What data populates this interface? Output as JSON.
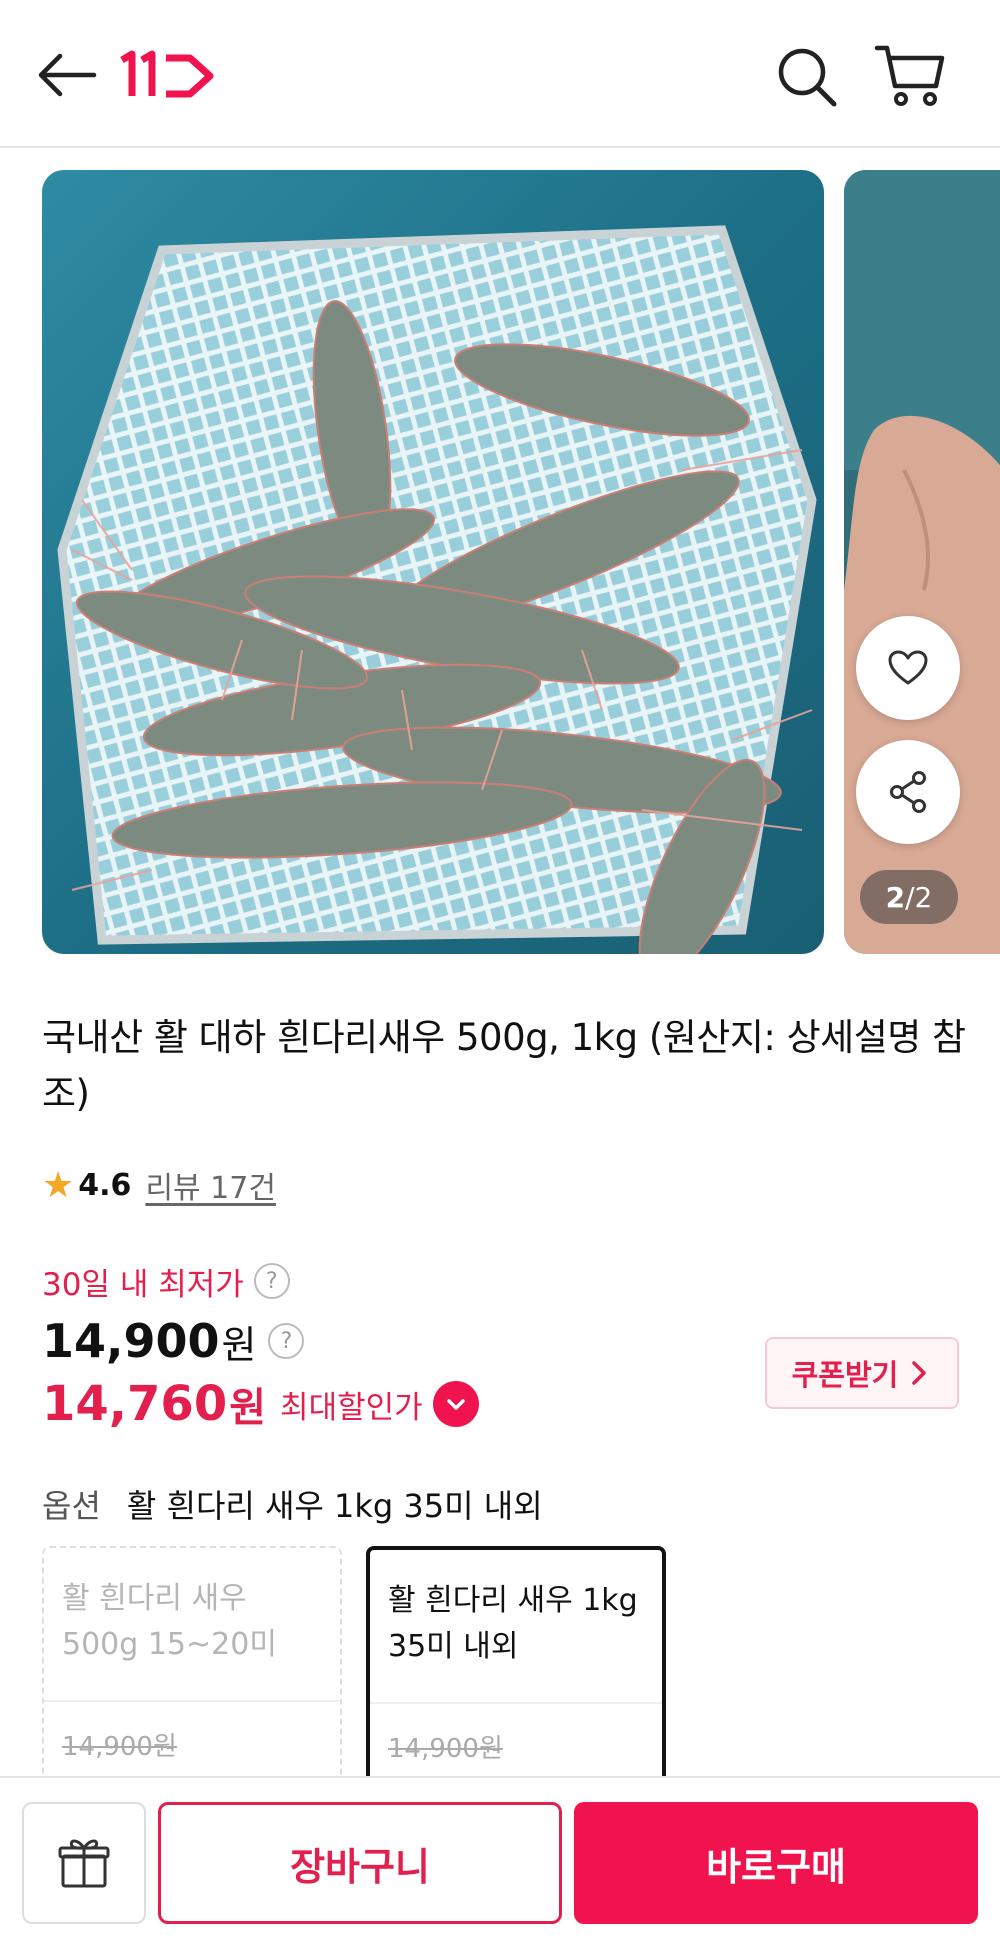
{
  "header": {
    "logo_text": "11"
  },
  "gallery": {
    "counter_current": "2",
    "counter_total": "/2"
  },
  "product": {
    "title": "국내산 활 대하 흰다리새우 500g, 1kg (원산지: 상세설명 참조)",
    "rating_star": "★",
    "rating": "4.6",
    "reviews_label": "리뷰 17건"
  },
  "pricing": {
    "lowest_label": "30일 내 최저가",
    "help_glyph": "?",
    "price": "14,900",
    "price_unit": "원",
    "sale_price": "14,760",
    "sale_unit": "원",
    "sale_label": "최대할인가",
    "coupon_label": "쿠폰받기"
  },
  "options": {
    "label": "옵션",
    "selected_value": "활 흰다리 새우 1kg 35미 내외",
    "cards": [
      {
        "name": "활 흰다리 새우 500g 15~20미",
        "price": "14,900원",
        "state": "disabled"
      },
      {
        "name": "활 흰다리 새우 1kg 35미 내외",
        "price": "14,900원",
        "state": "selected"
      }
    ]
  },
  "bottom": {
    "cart_label": "장바구니",
    "buy_label": "바로구매"
  },
  "colors": {
    "accent": "#f0134d",
    "accent_text": "#e3204d",
    "star": "#f5a623"
  },
  "icons": [
    "back-arrow-icon",
    "search-icon",
    "cart-icon",
    "heart-icon",
    "share-icon",
    "check-icon",
    "chevron-right-icon",
    "gift-icon",
    "question-icon",
    "star-icon"
  ]
}
